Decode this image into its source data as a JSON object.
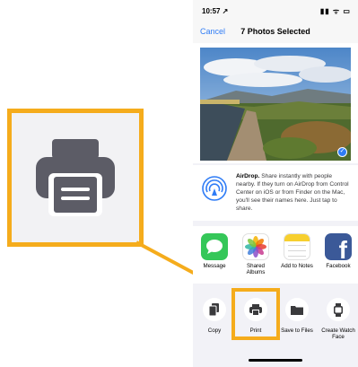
{
  "status_bar": {
    "time": "10:57 ↗",
    "icons": "▮▮ ᯤ ▭"
  },
  "nav": {
    "cancel_label": "Cancel",
    "title": "7 Photos Selected"
  },
  "airdrop": {
    "title": "AirDrop.",
    "text": " Share instantly with people nearby. If they turn on AirDrop from Control Center on iOS or from Finder on the Mac, you'll see their names here. Just tap to share."
  },
  "apps": [
    {
      "label": "Message",
      "icon": "message-icon"
    },
    {
      "label": "Shared Albums",
      "icon": "photos-icon"
    },
    {
      "label": "Add to Notes",
      "icon": "notes-icon"
    },
    {
      "label": "Facebook",
      "icon": "facebook-icon"
    }
  ],
  "actions": [
    {
      "label": "Copy",
      "icon": "copy-icon"
    },
    {
      "label": "Print",
      "icon": "print-icon"
    },
    {
      "label": "Save to Files",
      "icon": "folder-icon"
    },
    {
      "label": "Create Watch Face",
      "icon": "watch-icon"
    }
  ],
  "colors": {
    "accent": "#2f7cf6",
    "highlight": "#f5ac1c",
    "message_green": "#35c759",
    "facebook_blue": "#3b5998"
  }
}
